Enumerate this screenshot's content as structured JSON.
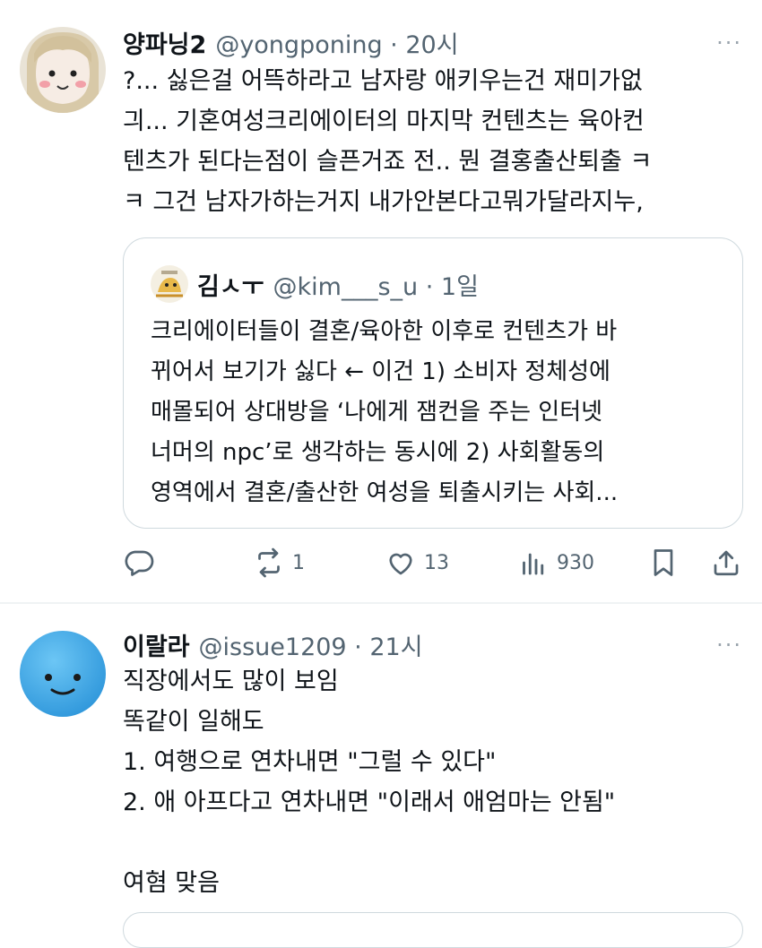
{
  "tweet1": {
    "name": "양파닝2",
    "handle": "@yongponing · 20시",
    "more": "···",
    "lines": [
      "?... 싫은걸 어뜩하라고 남자랑 애키우는건 재미가없",
      "긔... 기혼여성크리에이터의 마지막 컨텐츠는 육아컨",
      "텐츠가 된다는점이 슬픈거죠 전.. 뭔 결홍출산퇴출 ㅋ",
      "ㅋ 그건 남자가하는거지 내가안본다고뭐가달라지누,"
    ],
    "quote": {
      "name": "김ㅅㅜ",
      "handle": "@kim___s_u · 1일",
      "lines": [
        "크리에이터들이 결혼/육아한 이후로 컨텐츠가 바",
        "뀌어서 보기가 싫다 ← 이건 1) 소비자 정체성에",
        "매몰되어 상대방을 ‘나에게 잼컨을 주는 인터넷",
        "너머의 npc’로 생각하는 동시에 2) 사회활동의",
        "영역에서 결혼/출산한 여성을 퇴출시키는 사회..."
      ]
    },
    "actions": {
      "reply": "",
      "retweet": "1",
      "like": "13",
      "views": "930"
    }
  },
  "tweet2": {
    "name": "이랄라",
    "handle": "@issue1209 · 21시",
    "more": "···",
    "lines": [
      "직장에서도 많이 보임",
      "똑같이 일해도",
      "1. 여행으로 연차내면 \"그럴 수 있다\"",
      "2. 애 아프다고 연차내면 \"이래서 애엄마는 안됨\"",
      "",
      "여혐 맞음"
    ]
  },
  "colors": {
    "text": "#0f1419",
    "secondary": "#536471",
    "border": "#cfd9de",
    "avatar2": "#3aa3e3"
  }
}
